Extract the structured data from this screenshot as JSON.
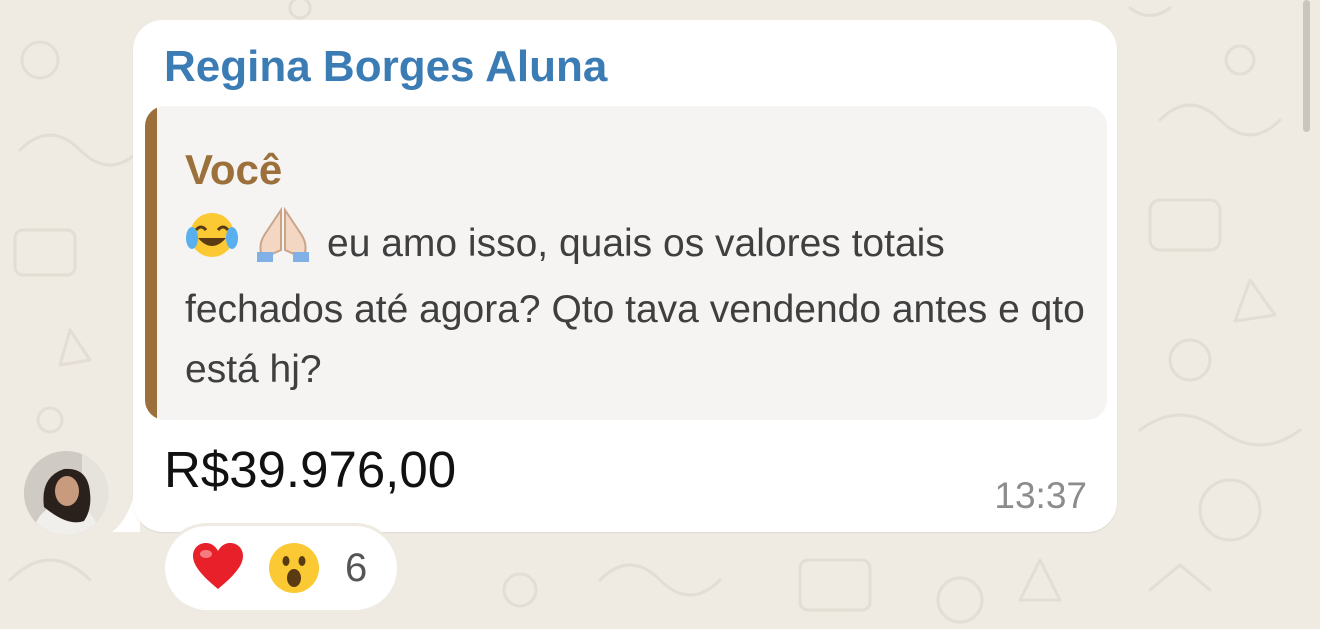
{
  "message": {
    "sender": "Regina Borges Aluna",
    "text": "R$39.976,00",
    "time": "13:37",
    "avatar_icon": "profile-photo-woman",
    "quoted": {
      "author": "Você",
      "emojis": [
        "face-with-tears-of-joy",
        "folded-hands"
      ],
      "text": "eu amo isso, quais os valores totais fechados até agora? Qto tava vendendo antes e qto está hj?"
    },
    "reactions": {
      "icons": [
        "red-heart",
        "face-with-open-mouth"
      ],
      "count": "6"
    }
  },
  "colors": {
    "background": "#efeae2",
    "bubble": "#ffffff",
    "sender": "#3b7cb4",
    "quote_accent": "#9b703b",
    "quote_background": "#f5f4f3",
    "timestamp": "#8c8c8c"
  }
}
